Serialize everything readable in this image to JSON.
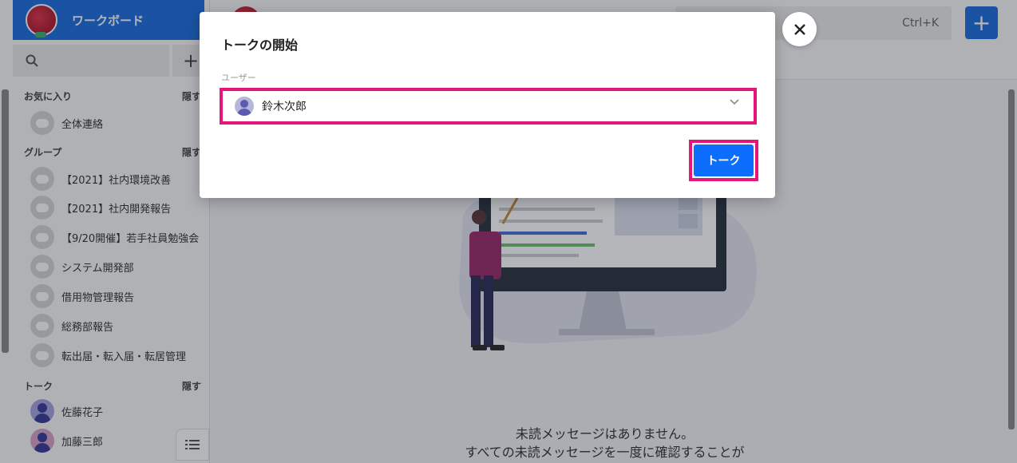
{
  "workspace": {
    "name": "ワークボード"
  },
  "top": {
    "shortcut_hint": "Ctrl+K",
    "add_label": "+"
  },
  "sidebar": {
    "add_label": "+",
    "favorites": {
      "title": "お気に入り",
      "hide": "隠す",
      "items": [
        {
          "label": "全体連絡"
        }
      ]
    },
    "groups": {
      "title": "グループ",
      "hide": "隠す",
      "items": [
        {
          "label": "【2021】社内環境改善"
        },
        {
          "label": "【2021】社内開発報告"
        },
        {
          "label": "【9/20開催】若手社員勉強会"
        },
        {
          "label": "システム開発部"
        },
        {
          "label": "借用物管理報告"
        },
        {
          "label": "総務部報告"
        },
        {
          "label": "転出届・転入届・転居管理"
        }
      ]
    },
    "talks": {
      "title": "トーク",
      "hide": "隠す",
      "items": [
        {
          "label": "佐藤花子",
          "color": "#a9a4e0"
        },
        {
          "label": "加藤三郎",
          "color": "#d8a4c8"
        }
      ]
    }
  },
  "main": {
    "empty_line1": "未読メッセージはありません。",
    "empty_line2": "すべての未読メッセージを一度に確認することが"
  },
  "modal": {
    "title": "トークの開始",
    "user_label": "ユーザー",
    "selected_user": "鈴木次郎",
    "submit_label": "トーク",
    "highlight_color": "#e5157a"
  },
  "colors": {
    "brand": "#1e6fe0",
    "button": "#0d6efd"
  }
}
